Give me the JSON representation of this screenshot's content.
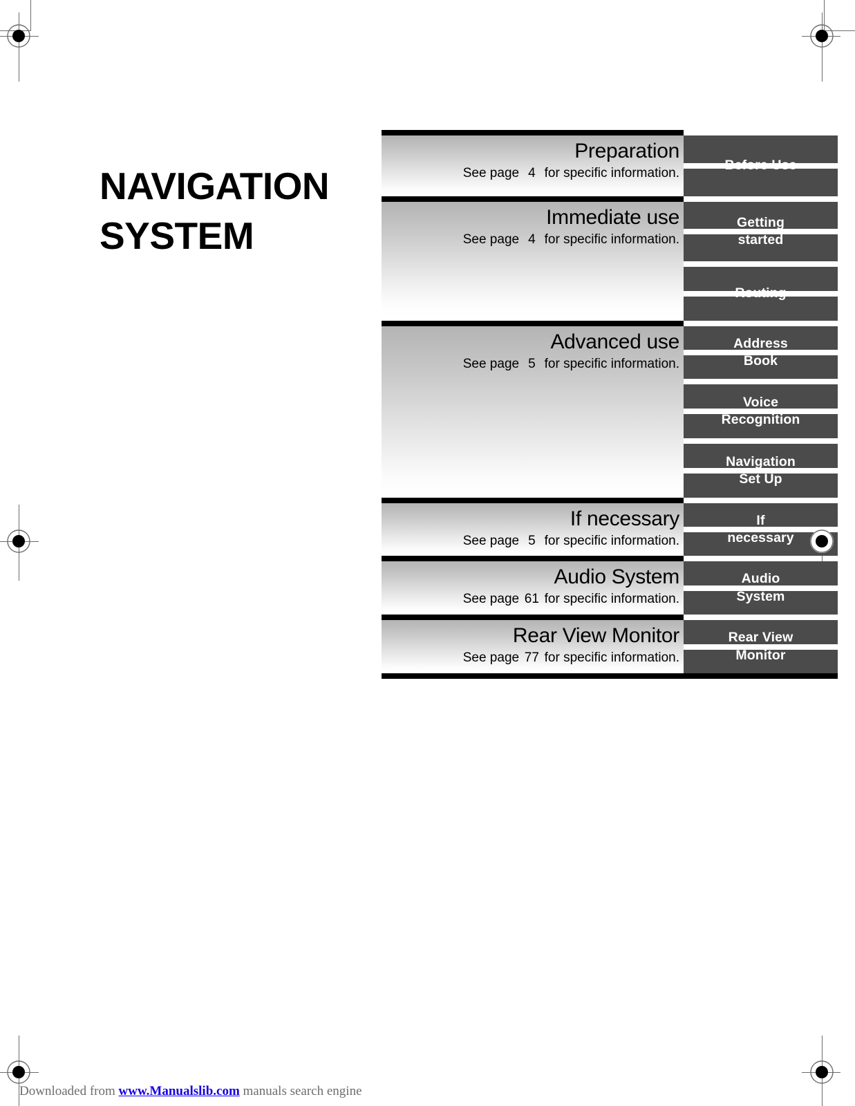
{
  "page": {
    "title": "NAVIGATION\nSYSTEM"
  },
  "nav_map": {
    "sections": [
      {
        "title": "Preparation",
        "see_prefix": "See page",
        "page": "4",
        "see_suffix": "for specific information.",
        "tabs": [
          {
            "label": "Before Use"
          }
        ]
      },
      {
        "title": "Immediate use",
        "see_prefix": "See page",
        "page": "4",
        "see_suffix": "for specific information.",
        "tabs": [
          {
            "label": "Getting\nstarted"
          },
          {
            "label": "Routing"
          }
        ]
      },
      {
        "title": "Advanced use",
        "see_prefix": "See page",
        "page": "5",
        "see_suffix": "for specific information.",
        "tabs": [
          {
            "label": "Address\nBook"
          },
          {
            "label": "Voice\nRecognition"
          },
          {
            "label": "Navigation\nSet Up"
          }
        ]
      },
      {
        "title": "If necessary",
        "see_prefix": "See page",
        "page": "5",
        "see_suffix": "for specific information.",
        "tabs": [
          {
            "label": "If\nnecessary"
          }
        ]
      },
      {
        "title": "Audio System",
        "see_prefix": "See page",
        "page": "61",
        "see_suffix": "for specific information.",
        "tabs": [
          {
            "label": "Audio\nSystem"
          }
        ]
      },
      {
        "title": "Rear View Monitor",
        "see_prefix": "See page",
        "page": "77",
        "see_suffix": "for specific information.",
        "tabs": [
          {
            "label": "Rear View\nMonitor"
          }
        ]
      }
    ]
  },
  "footer": {
    "prefix": "Downloaded from ",
    "link": "www.Manualslib.com",
    "suffix": " manuals search engine"
  },
  "colors": {
    "tab_background": "#4b4b4b",
    "tab_text": "#ffffff",
    "separator": "#000000",
    "link": "#1500e0",
    "footer_text": "#6d6d6d",
    "mark": "#6b6b6b"
  }
}
